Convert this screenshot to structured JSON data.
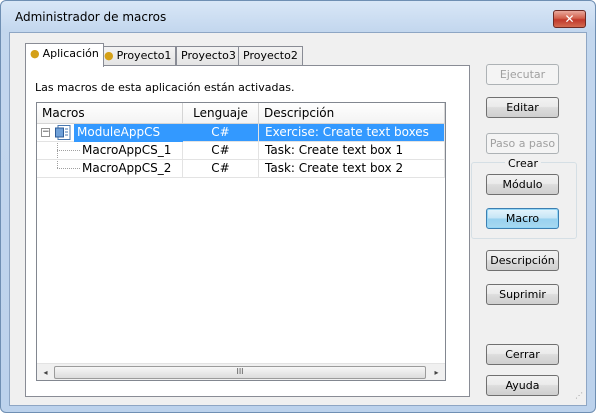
{
  "window": {
    "title": "Administrador de macros",
    "close_glyph": "✕"
  },
  "tabs": [
    {
      "label": "Aplicación",
      "icon": "lightbulb-icon"
    },
    {
      "label": "Proyecto1",
      "icon": "lightbulb-icon"
    },
    {
      "label": "Proyecto3"
    },
    {
      "label": "Proyecto2"
    }
  ],
  "status_message": "Las macros de esta aplicación están activadas.",
  "list": {
    "columns": [
      "Macros",
      "Lenguaje",
      "Descripción"
    ],
    "rows": [
      {
        "name": "ModuleAppCS",
        "language": "C#",
        "description": "Exercise: Create text boxes",
        "selected": true
      },
      {
        "name": "MacroAppCS_1",
        "language": "C#",
        "description": "Task: Create text box 1"
      },
      {
        "name": "MacroAppCS_2",
        "language": "C#",
        "description": "Task: Create text box 2"
      }
    ],
    "scrollbar": {
      "left": "◂",
      "right": "▸",
      "grip": "III"
    },
    "expander": "−"
  },
  "buttons": {
    "run": "Ejecutar",
    "edit": "Editar",
    "step": "Paso a paso",
    "create_group": "Crear",
    "module": "Módulo",
    "macro": "Macro",
    "description": "Descripción",
    "delete": "Suprimir",
    "close": "Cerrar",
    "help": "Ayuda"
  },
  "colors": {
    "selection": "#3399ff",
    "close_button": "#c0392b"
  }
}
